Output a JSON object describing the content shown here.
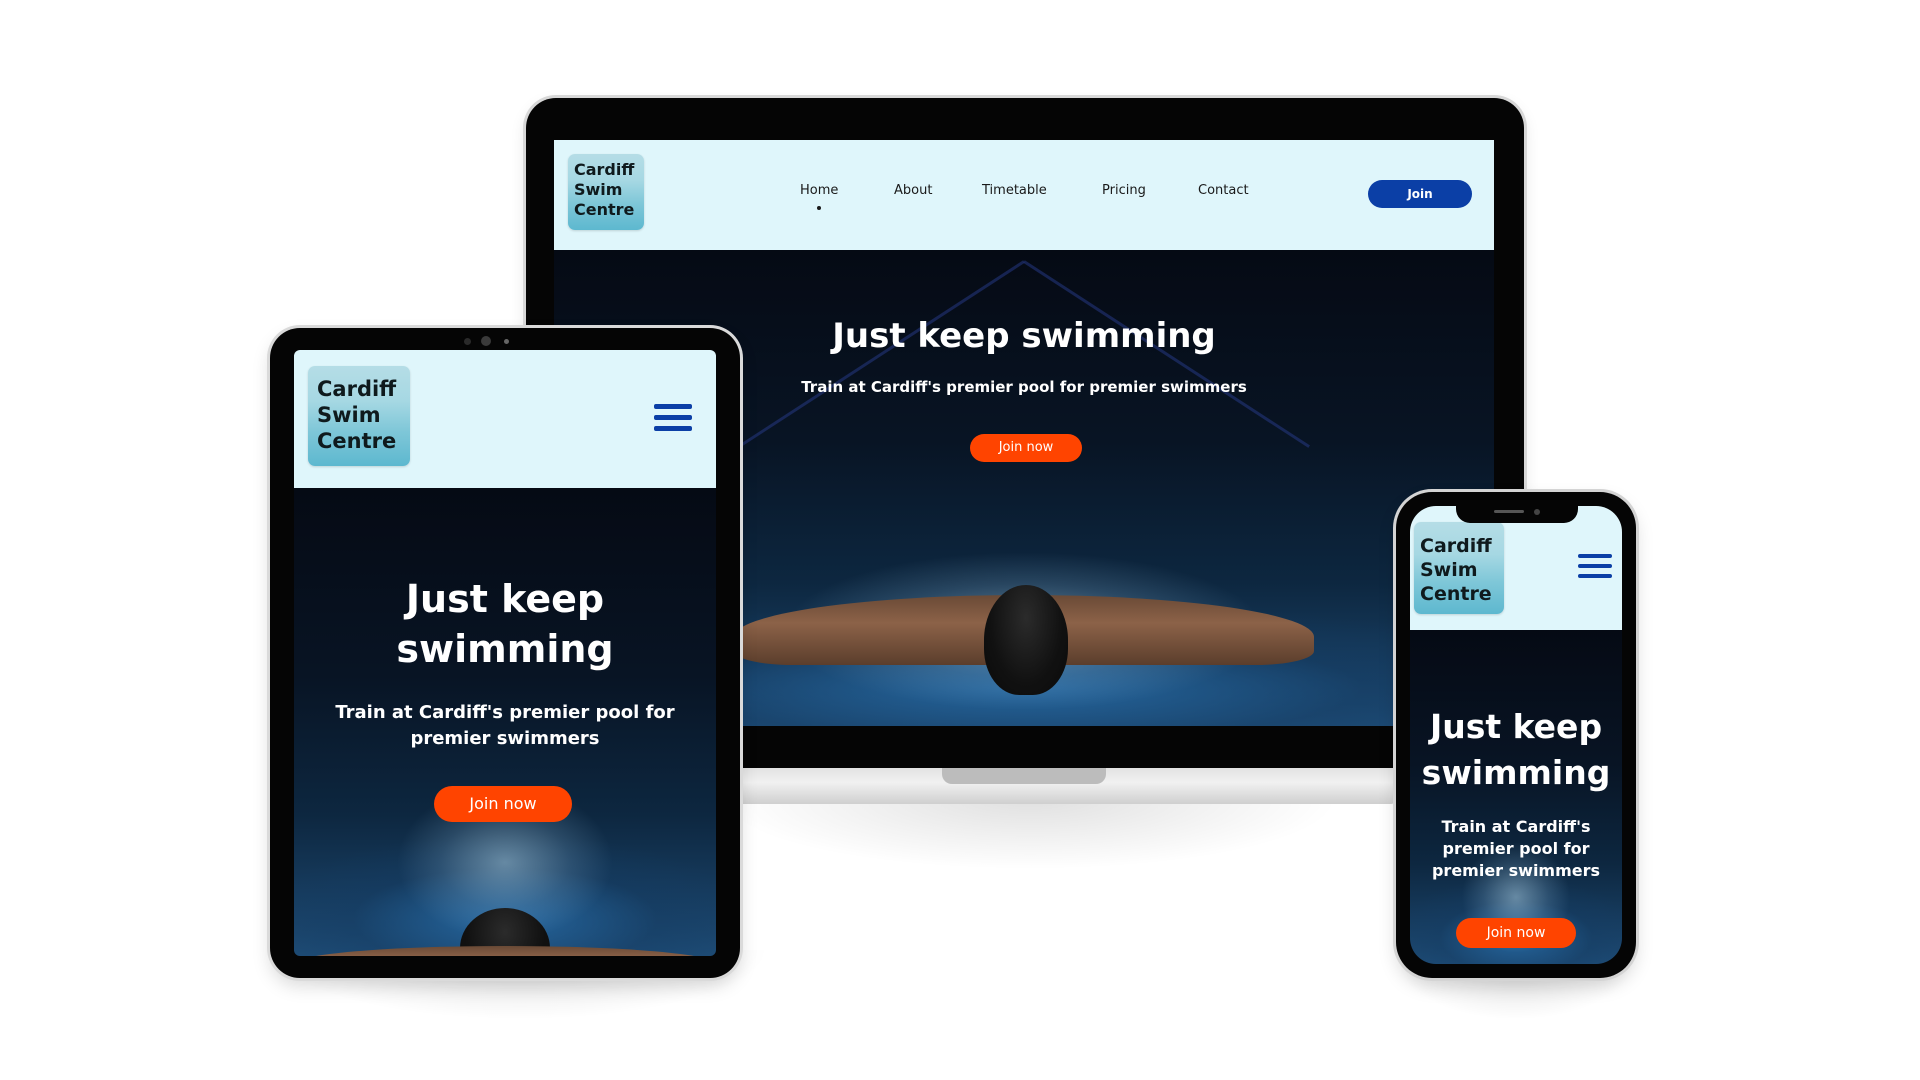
{
  "site": {
    "logo": {
      "line1": "Cardiff",
      "line2": "Swim",
      "line3": "Centre"
    },
    "nav": {
      "home": "Home",
      "about": "About",
      "timetable": "Timetable",
      "pricing": "Pricing",
      "contact": "Contact",
      "join": "Join"
    },
    "hero": {
      "title": "Just keep swimming",
      "title_line1": "Just keep",
      "title_line2": "swimming",
      "subtitle": "Train at Cardiff's premier pool for premier swimmers",
      "tablet_sub_line1": "Train at Cardiff's premier pool for",
      "tablet_sub_line2": "premier swimmers",
      "phone_sub_line1": "Train at Cardiff's",
      "phone_sub_line2": "premier pool for",
      "phone_sub_line3": "premier swimmers",
      "cta": "Join now"
    }
  },
  "colors": {
    "header_bg": "#dff6fb",
    "brand_blue": "#0b3fa6",
    "cta_orange": "#ff4400",
    "hero_dark": "#081424"
  },
  "icons": {
    "menu": "hamburger-menu-icon"
  }
}
